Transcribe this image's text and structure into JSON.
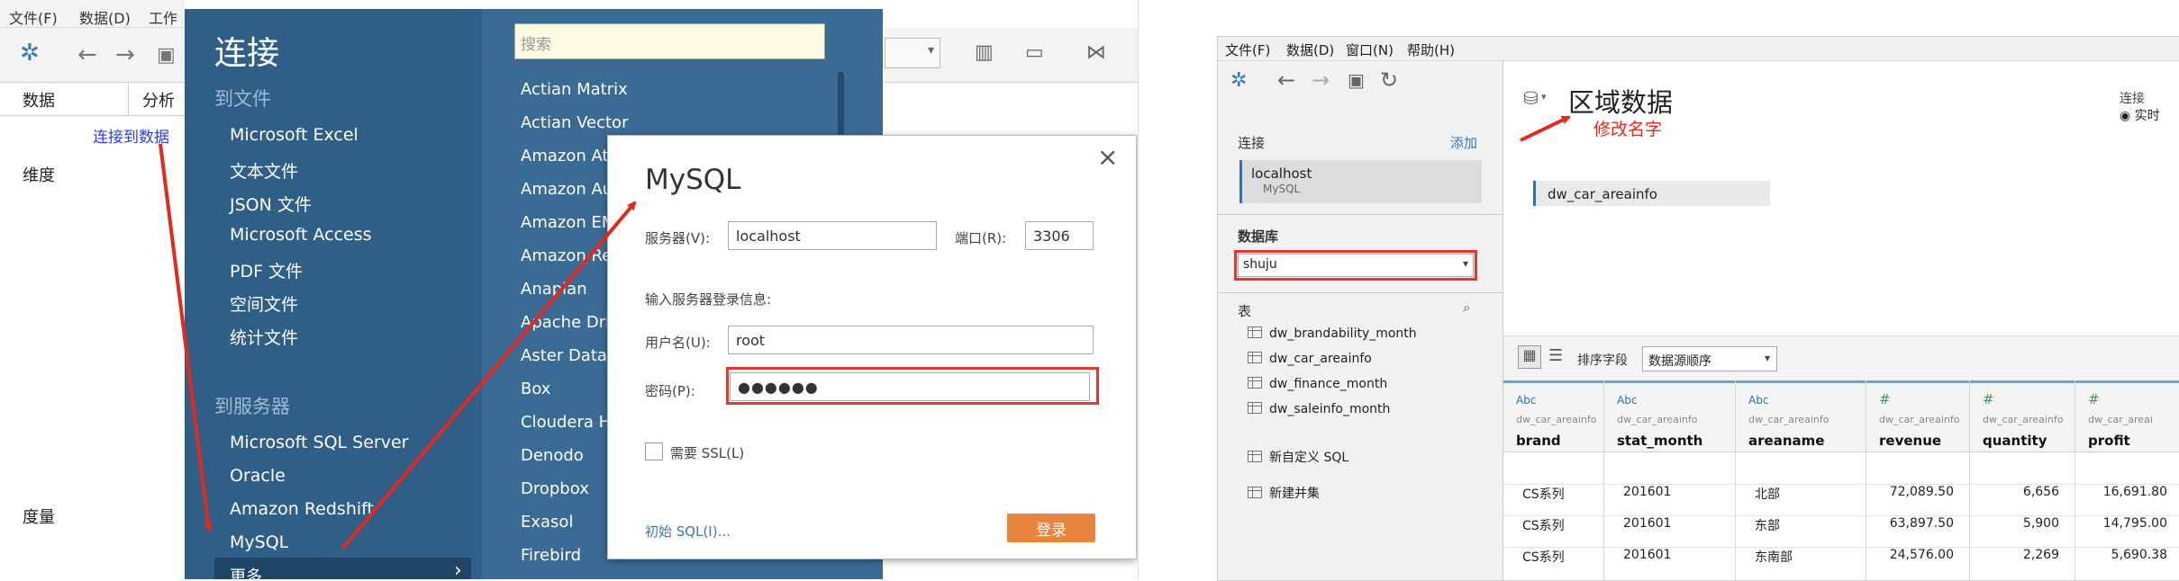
{
  "left": {
    "menubar": [
      "文件(F)",
      "数据(D)",
      "工作"
    ],
    "tabs": {
      "data": "数据",
      "analysis": "分析"
    },
    "connect_link": "连接到数据",
    "dimensions": "维度",
    "measures": "度量",
    "connect_panel": {
      "title": "连接",
      "to_file": "到文件",
      "file_items": [
        "Microsoft Excel",
        "文本文件",
        "JSON 文件",
        "Microsoft Access",
        "PDF 文件",
        "空间文件",
        "统计文件"
      ],
      "to_server": "到服务器",
      "server_items": [
        "Microsoft SQL Server",
        "Oracle",
        "Amazon Redshift",
        "MySQL"
      ],
      "more": "更多"
    },
    "connector_list": {
      "search_placeholder": "搜索",
      "items": [
        "Actian Matrix",
        "Actian Vector",
        "Amazon Ath",
        "Amazon Au",
        "Amazon EM",
        "Amazon Red",
        "Anaplan",
        "Apache Drill",
        "Aster Datab",
        "Box",
        "Cloudera Ha",
        "Denodo",
        "Dropbox",
        "Exasol",
        "Firebird"
      ]
    },
    "dialog": {
      "title": "MySQL",
      "close": "×",
      "server_label": "服务器(V):",
      "server_value": "localhost",
      "port_label": "端口(R):",
      "port_value": "3306",
      "login_info": "输入服务器登录信息:",
      "username_label": "用户名(U):",
      "username_value": "root",
      "password_label": "密码(P):",
      "password_value": "●●●●●●",
      "ssl_label": "需要 SSL(L)",
      "initial_sql": "初始 SQL(I)...",
      "login_button": "登录"
    }
  },
  "right": {
    "menubar": [
      "文件(F)",
      "数据(D)",
      "窗口(N)",
      "帮助(H)"
    ],
    "sidebar": {
      "connections_label": "连接",
      "add_link": "添加",
      "connection_name": "localhost",
      "connection_type": "MySQL",
      "database_label": "数据库",
      "database_value": "shuju",
      "tables_label": "表",
      "tables": [
        "dw_brandability_month",
        "dw_car_areainfo",
        "dw_finance_month",
        "dw_saleinfo_month"
      ],
      "new_custom_sql": "新自定义 SQL",
      "new_union": "新建并集"
    },
    "main": {
      "source_title": "区域数据",
      "annotation": "修改名字",
      "connection_label": "连接",
      "connection_mode": "实时",
      "table_chip": "dw_car_areainfo",
      "sort_label": "排序字段",
      "sort_value": "数据源顺序",
      "columns": [
        {
          "type": "Abc",
          "source": "dw_car_areainfo",
          "name": "brand"
        },
        {
          "type": "Abc",
          "source": "dw_car_areainfo",
          "name": "stat_month"
        },
        {
          "type": "Abc",
          "source": "dw_car_areainfo",
          "name": "areaname"
        },
        {
          "type": "#",
          "source": "dw_car_areainfo",
          "name": "revenue"
        },
        {
          "type": "#",
          "source": "dw_car_areainfo",
          "name": "quantity"
        },
        {
          "type": "#",
          "source": "dw_car_areai",
          "name": "profit"
        }
      ],
      "rows": [
        [
          "CS系列",
          "201601",
          "北部",
          "72,089.50",
          "6,656",
          "16,691.80"
        ],
        [
          "CS系列",
          "201601",
          "东部",
          "63,897.50",
          "5,900",
          "14,795.00"
        ],
        [
          "CS系列",
          "201601",
          "东南部",
          "24,576.00",
          "2,269",
          "5,690.38"
        ]
      ]
    }
  },
  "colors": {
    "accent_red": "#e23a32",
    "tableau_blue": "#2f5f87",
    "login_orange": "#e8843c"
  }
}
